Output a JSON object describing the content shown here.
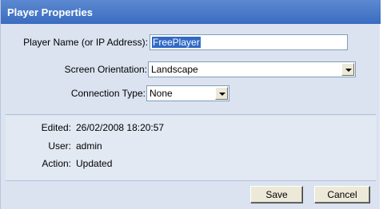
{
  "dialog": {
    "title": "Player Properties"
  },
  "form": {
    "player_name_label": "Player Name (or IP Address):",
    "player_name_value": "FreePlayer",
    "orientation_label": "Screen Orientation:",
    "orientation_value": "Landscape",
    "connection_label": "Connection Type:",
    "connection_value": "None"
  },
  "info": {
    "edited_label": "Edited:",
    "edited_value": "26/02/2008 18:20:57",
    "user_label": "User:",
    "user_value": "admin",
    "action_label": "Action:",
    "action_value": "Updated"
  },
  "buttons": {
    "save_label": "Save",
    "cancel_label": "Cancel"
  },
  "colors": {
    "titlebar": "#3a6cc0",
    "panel": "#dbe3f0",
    "selection": "#316ac5"
  }
}
